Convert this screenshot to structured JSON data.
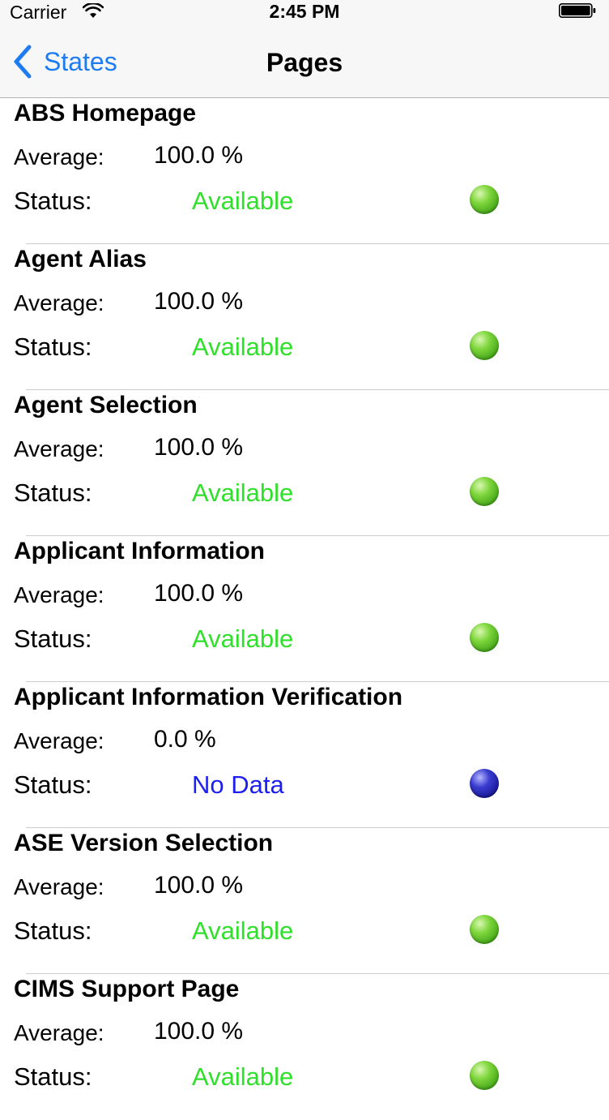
{
  "status_bar": {
    "carrier": "Carrier",
    "time": "2:45 PM"
  },
  "nav": {
    "back_label": "States",
    "title": "Pages"
  },
  "labels": {
    "average": "Average:",
    "status": "Status:"
  },
  "colors": {
    "available": "#2fe02a",
    "no_data": "#1c1ff0",
    "tint": "#1e7cf2"
  },
  "pages": [
    {
      "name": "ABS Homepage",
      "average": "100.0 %",
      "status": "Available",
      "indicator": "green"
    },
    {
      "name": "Agent Alias",
      "average": "100.0 %",
      "status": "Available",
      "indicator": "green"
    },
    {
      "name": "Agent Selection",
      "average": "100.0 %",
      "status": "Available",
      "indicator": "green"
    },
    {
      "name": "Applicant Information",
      "average": "100.0 %",
      "status": "Available",
      "indicator": "green"
    },
    {
      "name": "Applicant Information Verification",
      "average": "0.0 %",
      "status": "No Data",
      "indicator": "blue"
    },
    {
      "name": "ASE Version Selection",
      "average": "100.0 %",
      "status": "Available",
      "indicator": "green"
    },
    {
      "name": "CIMS Support Page",
      "average": "100.0 %",
      "status": "Available",
      "indicator": "green"
    }
  ]
}
